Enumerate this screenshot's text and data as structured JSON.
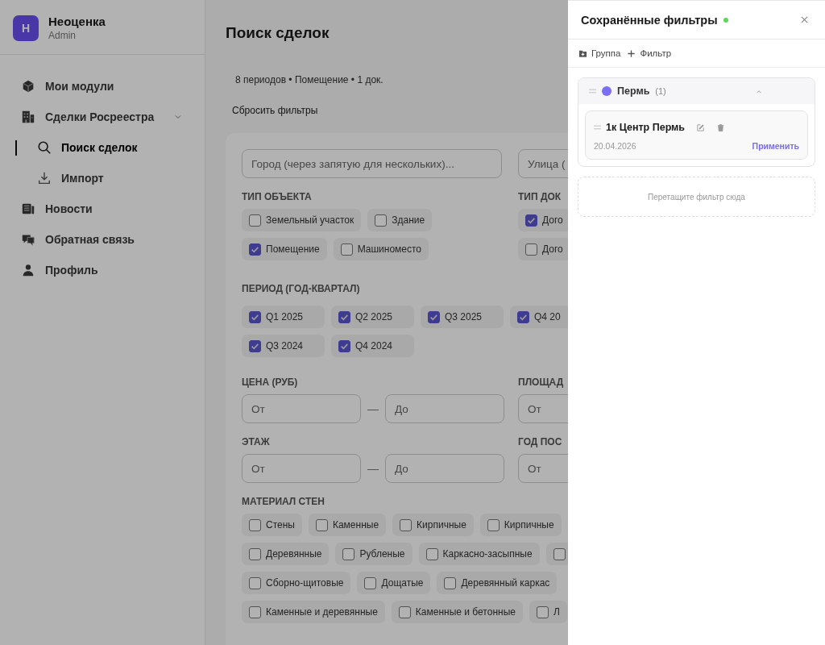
{
  "sidebar": {
    "brand": {
      "avatar": "Н",
      "name": "Неоценка",
      "role": "Admin"
    },
    "items": [
      {
        "label": "Мои модули",
        "selected": false
      },
      {
        "label": "Сделки Росреестра",
        "selected": false,
        "expanded": true,
        "children": [
          {
            "label": "Поиск сделок",
            "selected": true
          },
          {
            "label": "Импорт",
            "selected": false
          }
        ]
      },
      {
        "label": "Новости",
        "selected": false
      },
      {
        "label": "Обратная связь",
        "selected": false
      },
      {
        "label": "Профиль",
        "selected": false
      }
    ]
  },
  "page": {
    "title": "Поиск сделок",
    "summary": "8 периодов • Помещение • 1 док.",
    "reset_button": "Сбросить фильтры"
  },
  "filters": {
    "city_field": {
      "placeholder": "Город (через запятую для нескольких)..."
    },
    "street_field": {
      "placeholder": "Улица ("
    },
    "object_type": {
      "label": "ТИП ОБЪЕКТА",
      "rows": [
        [
          {
            "label": "Земельный участок",
            "checked": false
          },
          {
            "label": "Здание",
            "checked": false
          }
        ],
        [
          {
            "label": "Помещение",
            "checked": true
          },
          {
            "label": "Машиноместо",
            "checked": false
          }
        ]
      ]
    },
    "doc_type": {
      "label": "ТИП ДОК",
      "rows": [
        [
          {
            "label": "Дого",
            "checked": true
          }
        ],
        [
          {
            "label": "Дого",
            "checked": false
          }
        ]
      ]
    },
    "period": {
      "label": "ПЕРИОД (ГОД-КВАРТАЛ)",
      "rows": [
        [
          {
            "label": "Q1 2025",
            "checked": true
          },
          {
            "label": "Q2 2025",
            "checked": true
          },
          {
            "label": "Q3 2025",
            "checked": true
          },
          {
            "label": "Q4 20",
            "checked": true
          }
        ],
        [
          {
            "label": "Q3 2024",
            "checked": true
          },
          {
            "label": "Q4 2024",
            "checked": true
          }
        ]
      ]
    },
    "price": {
      "label": "ЦЕНА (РУБ)",
      "from": {
        "placeholder": "От"
      },
      "separator": "—",
      "to": {
        "placeholder": "До"
      }
    },
    "area": {
      "label": "ПЛОЩАД",
      "from": {
        "placeholder": "От"
      }
    },
    "floor": {
      "label": "ЭТАЖ",
      "from": {
        "placeholder": "От"
      },
      "separator": "—",
      "to": {
        "placeholder": "До"
      }
    },
    "year": {
      "label": "ГОД ПОС",
      "from": {
        "placeholder": "От"
      }
    },
    "wall_material": {
      "label": "МАТЕРИАЛ СТЕН",
      "rows": [
        [
          {
            "label": "Стены",
            "checked": false
          },
          {
            "label": "Каменные",
            "checked": false
          },
          {
            "label": "Кирпичные",
            "checked": false
          },
          {
            "label": "Кирпичные",
            "checked": false
          }
        ],
        [
          {
            "label": "Деревянные",
            "checked": false
          },
          {
            "label": "Рубленые",
            "checked": false
          },
          {
            "label": "Каркасно-засыпные",
            "checked": false
          },
          {
            "checked": false
          }
        ],
        [
          {
            "label": "Сборно-щитовые",
            "checked": false
          },
          {
            "label": "Дощатые",
            "checked": false
          },
          {
            "label": "Деревянный каркас",
            "checked": false
          }
        ],
        [
          {
            "label": "Каменные и деревянные",
            "checked": false
          },
          {
            "label": "Каменные и бетонные",
            "checked": false
          },
          {
            "label": "Л",
            "checked": false
          }
        ]
      ]
    }
  },
  "drawer": {
    "title": "Сохранённые фильтры",
    "online": true,
    "toolbar": [
      {
        "kind": "group",
        "label": "Группа"
      },
      {
        "kind": "filter",
        "label": "Фильтр"
      }
    ],
    "groups": [
      {
        "name": "Пермь",
        "count": "(1)",
        "color": "#7b6ef6",
        "expanded": true,
        "filters": [
          {
            "name": "1к Центр Пермь",
            "date": "20.04.2026",
            "apply": "Применить"
          }
        ]
      }
    ],
    "dropzone": "Перетащите фильтр сюда"
  }
}
